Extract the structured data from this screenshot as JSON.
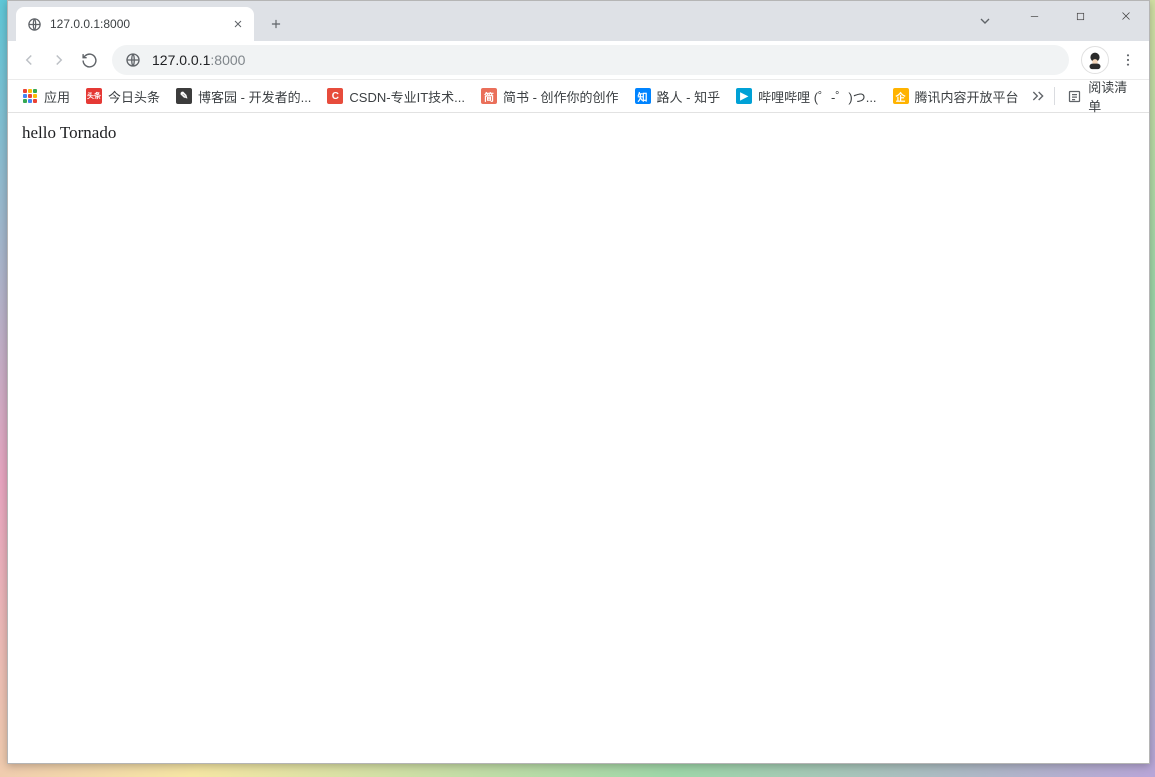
{
  "window": {
    "tab_title": "127.0.0.1:8000",
    "url_host": "127.0.0.1",
    "url_port": ":8000"
  },
  "bookmarks": {
    "apps_label": "应用",
    "items": [
      {
        "label": "今日头条",
        "bg": "#e53935",
        "text": "头条"
      },
      {
        "label": "博客园 - 开发者的...",
        "bg": "#3c3c3c",
        "text": "✎"
      },
      {
        "label": "CSDN-专业IT技术...",
        "bg": "#e74c3c",
        "text": "C"
      },
      {
        "label": "简书 - 创作你的创作",
        "bg": "#ea6f5a",
        "text": "简"
      },
      {
        "label": "路人 - 知乎",
        "bg": "#0084ff",
        "text": "知"
      },
      {
        "label": "哔哩哔哩 (゜-゜)つ...",
        "bg": "#00a1d6",
        "text": "▶"
      },
      {
        "label": "腾讯内容开放平台",
        "bg": "#ffb300",
        "text": "企"
      }
    ],
    "reading_list_label": "阅读清单"
  },
  "page": {
    "body_text": "hello Tornado"
  }
}
